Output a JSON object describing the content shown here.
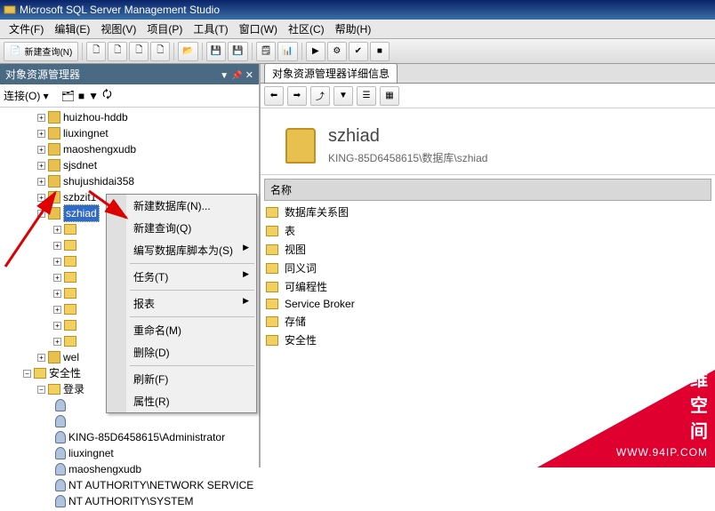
{
  "window": {
    "title": "Microsoft SQL Server Management Studio"
  },
  "menu": {
    "file": "文件(F)",
    "edit": "编辑(E)",
    "view": "视图(V)",
    "project": "项目(P)",
    "tools": "工具(T)",
    "window": "窗口(W)",
    "community": "社区(C)",
    "help": "帮助(H)"
  },
  "toolbar": {
    "new_query": "新建查询(N)"
  },
  "obj_explorer": {
    "title": "对象资源管理器",
    "connect_label": "连接(O)"
  },
  "tree": {
    "items_top": [
      {
        "label": "huizhou-hddb"
      },
      {
        "label": "liuxingnet"
      },
      {
        "label": "maoshengxudb"
      },
      {
        "label": "sjsdnet"
      },
      {
        "label": "shujushidai358"
      },
      {
        "label": "szbzit1"
      }
    ],
    "selected": "szhiad",
    "wel_label": "wel",
    "security": "安全性",
    "logins": "登录",
    "users": [
      "KING-85D6458615\\Administrator",
      "liuxingnet",
      "maoshengxudb",
      "NT AUTHORITY\\NETWORK SERVICE",
      "NT AUTHORITY\\SYSTEM"
    ]
  },
  "context_menu": {
    "new_db": "新建数据库(N)...",
    "new_query": "新建查询(Q)",
    "script_as": "编写数据库脚本为(S)",
    "tasks": "任务(T)",
    "reports": "报表",
    "rename": "重命名(M)",
    "delete": "删除(D)",
    "refresh": "刷新(F)",
    "properties": "属性(R)"
  },
  "detail": {
    "tab": "对象资源管理器详细信息",
    "db_name": "szhiad",
    "path": "KING-85D6458615\\数据库\\szhiad",
    "col_name": "名称",
    "rows": [
      "数据库关系图",
      "表",
      "视图",
      "同义词",
      "可编程性",
      "Service Broker",
      "存储",
      "安全性"
    ]
  },
  "watermark": {
    "text": "IT运维空间",
    "url": "WWW.94IP.COM"
  }
}
